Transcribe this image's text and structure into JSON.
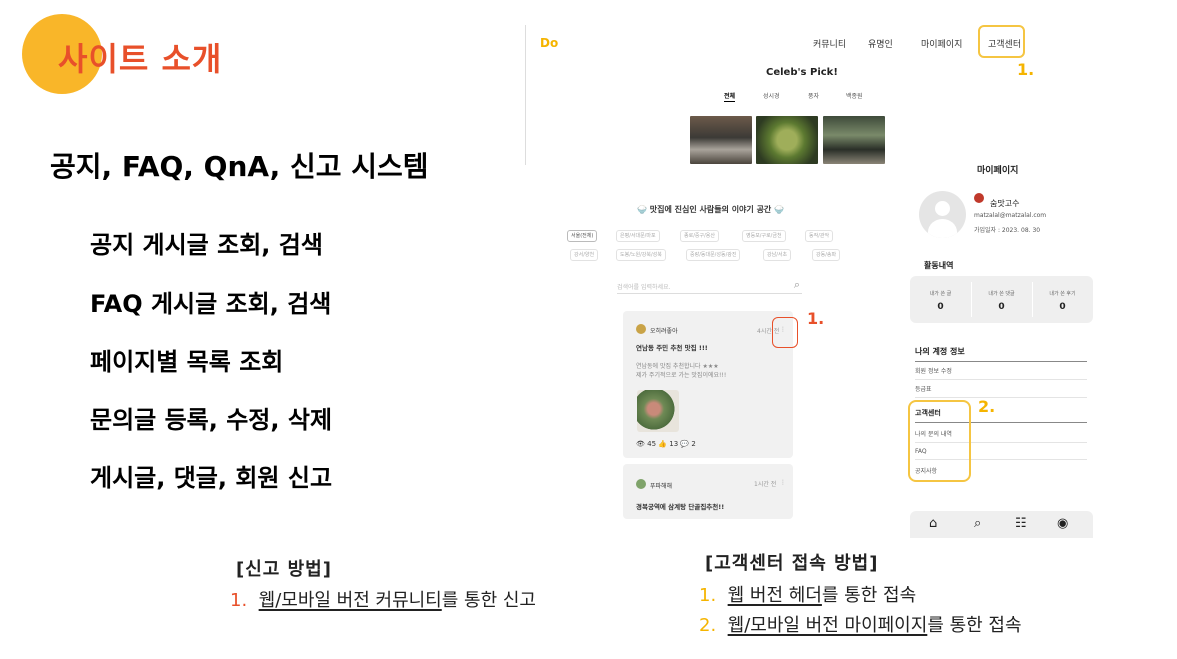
{
  "slide": {
    "title": "사이트 소개",
    "subtitle": "공지, FAQ, QnA, 신고 시스템",
    "features": [
      "공지 게시글 조회, 검색",
      "FAQ 게시글 조회, 검색",
      "페이지별 목록 조회",
      "문의글 등록, 수정, 삭제",
      "게시글, 댓글, 회원 신고"
    ],
    "colors": {
      "accent": "#e8502a",
      "highlight": "#f5b400",
      "circle": "#f9b629"
    }
  },
  "report_caption": {
    "heading": "[신고 방법]",
    "items": [
      {
        "num": "1.",
        "underlined": "웹/모바일 버전 커뮤니티",
        "rest": "를 통한 신고"
      }
    ]
  },
  "support_caption": {
    "heading": "[고객센터 접속 방법]",
    "items": [
      {
        "num": "1.",
        "underlined": "웹 버전 헤더",
        "rest": "를 통한 접속"
      },
      {
        "num": "2.",
        "underlined": "웹/모바일 버전 마이페이지",
        "rest": "를 통한 접속"
      }
    ]
  },
  "web_header": {
    "logo_main": "D",
    "logo_accent": "o",
    "nav": [
      "커뮤니티",
      "유명인",
      "마이페이지",
      "고객센터"
    ],
    "callout": "1.",
    "celeb_title": "Celeb's Pick!",
    "tabs": [
      "전체",
      "성시경",
      "풍자",
      "백종원"
    ]
  },
  "community": {
    "title": "🍚 맛집에 진심인 사람들의 이야기 공간 🍚",
    "chips_row1": [
      "서울(전체)",
      "은평/서대문/마포",
      "종로/중구/용산",
      "영등포/구로/금천",
      "동작/관악"
    ],
    "chips_row2": [
      "강서/양천",
      "도봉/노원/강북/성북",
      "중랑/동대문/성동/광진",
      "강남/서초",
      "강동/송파"
    ],
    "search_placeholder": "검색어를 입력하세요.",
    "callout": "1.",
    "post1": {
      "author": "오히려좋아",
      "time": "4시간 전",
      "menu": "⋮",
      "title": "연남동 주민 추천 맛집 !!!",
      "body1": "연남동에 맛집 추천합니다 ★★★",
      "body2": "제가 주기적으로 가는 맛집이에요!!!",
      "views": "45",
      "likes": "13",
      "comments": "2"
    },
    "post2": {
      "author": "푸파해해",
      "time": "1시간 전",
      "menu": "⋮",
      "title": "경복궁역에 삼계탕 단골집추천!!"
    }
  },
  "mypage": {
    "title": "마이페이지",
    "nickname": "숨맛고수",
    "email": "matzalal@matzalal.com",
    "joined": "가입일자 : 2023. 08. 30",
    "activity_heading": "활동내역",
    "stats": [
      {
        "label": "내가 쓴 글",
        "value": "0"
      },
      {
        "label": "내가 쓴 댓글",
        "value": "0"
      },
      {
        "label": "내가 쓴 후기",
        "value": "0"
      }
    ],
    "account_heading": "나의 계정 정보",
    "account_rows": [
      "회원 정보 수정",
      "등급표"
    ],
    "support_heading": "고객센터",
    "support_rows": [
      "나의 문의 내역",
      "FAQ",
      "공지사항"
    ],
    "callout": "2."
  }
}
